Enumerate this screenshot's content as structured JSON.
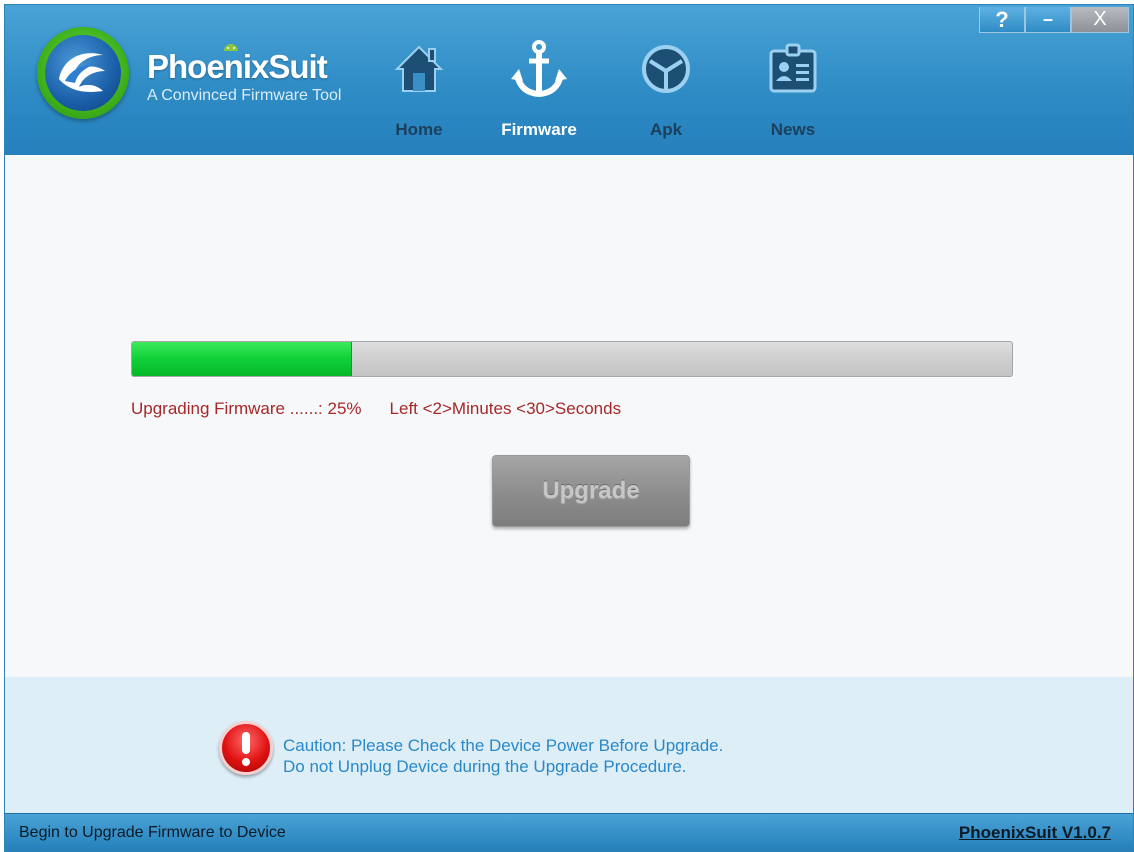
{
  "app": {
    "title": "PhoenixSuit",
    "subtitle": "A Convinced Firmware Tool"
  },
  "window_controls": {
    "help": "?",
    "minimize": "–",
    "close": "X"
  },
  "nav": [
    {
      "label": "Home",
      "icon": "home-icon",
      "active": false
    },
    {
      "label": "Firmware",
      "icon": "anchor-icon",
      "active": true
    },
    {
      "label": "Apk",
      "icon": "apk-icon",
      "active": false
    },
    {
      "label": "News",
      "icon": "news-icon",
      "active": false
    }
  ],
  "progress": {
    "percent": 25,
    "label": "Upgrading Firmware ......: 25%",
    "remaining": "Left <2>Minutes <30>Seconds"
  },
  "upgrade_button": {
    "label": "Upgrade",
    "enabled": false
  },
  "caution": {
    "icon": "exclamation-icon",
    "line1": "Caution: Please Check the Device Power Before Upgrade.",
    "line2": "Do not Unplug Device during the Upgrade Procedure."
  },
  "statusbar": {
    "message": "Begin to Upgrade Firmware to Device",
    "version": "PhoenixSuit V1.0.7"
  },
  "colors": {
    "header": "#2f8cc5",
    "progress_fill": "#12d33a",
    "status_text": "#a62828",
    "caution_text": "#2a88c8"
  }
}
